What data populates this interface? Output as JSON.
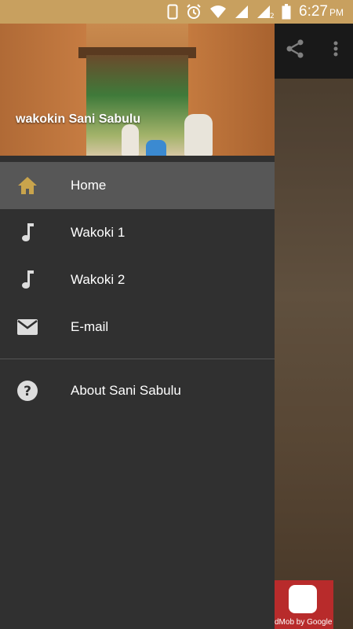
{
  "status_bar": {
    "time": "6:27",
    "ampm": "PM",
    "icons": [
      "phone-outline-icon",
      "alarm-icon",
      "wifi-icon",
      "signal-1-icon",
      "signal-2-icon",
      "battery-icon"
    ]
  },
  "toolbar": {
    "icons": [
      "share-icon",
      "more-vert-icon"
    ]
  },
  "drawer": {
    "header_title": "wakokin Sani Sabulu",
    "items": [
      {
        "label": "Home",
        "icon": "home-icon",
        "active": true
      },
      {
        "label": "Wakoki 1",
        "icon": "music-note-icon",
        "active": false
      },
      {
        "label": "Wakoki 2",
        "icon": "music-note-icon",
        "active": false
      },
      {
        "label": "E-mail",
        "icon": "mail-icon",
        "active": false
      }
    ],
    "secondary_items": [
      {
        "label": "About Sani Sabulu",
        "icon": "help-icon"
      }
    ]
  },
  "ad": {
    "text": "dMob by Google"
  },
  "colors": {
    "status_bar": "#c8a05f",
    "drawer_bg": "#303030",
    "active_item_bg": "#575757",
    "home_icon": "#c9a44c",
    "ad_bg": "#b82b2b"
  }
}
